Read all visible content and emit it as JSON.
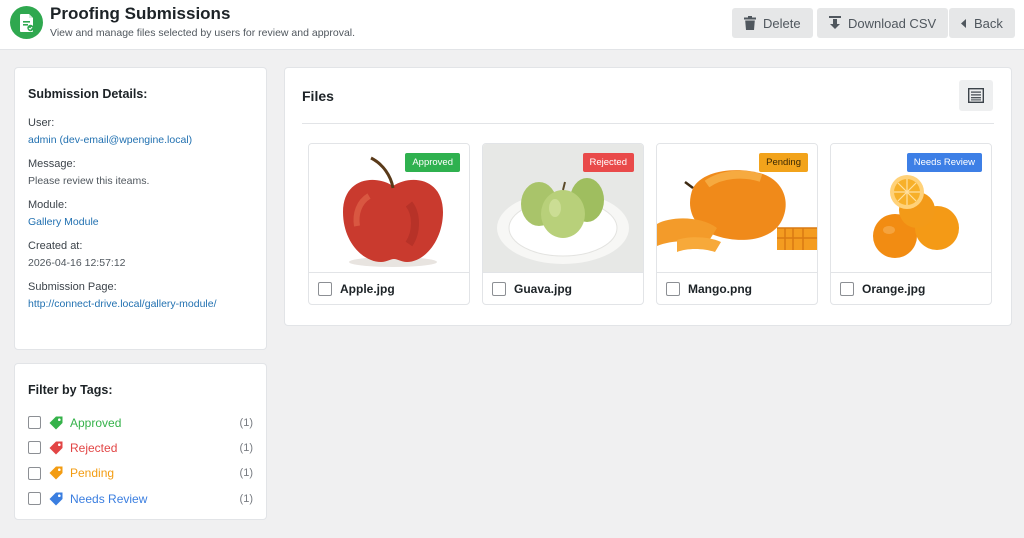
{
  "header": {
    "title": "Proofing Submissions",
    "subtitle": "View and manage files selected by users for review and approval.",
    "buttons": {
      "delete": "Delete",
      "download": "Download CSV",
      "back": "Back"
    }
  },
  "details": {
    "heading": "Submission Details:",
    "user_label": "User:",
    "user_value": "admin (dev-email@wpengine.local)",
    "message_label": "Message:",
    "message_value": "Please review this iteams.",
    "module_label": "Module:",
    "module_value": "Gallery Module",
    "created_label": "Created at:",
    "created_value": "2026-04-16 12:57:12",
    "page_label": "Submission Page:",
    "page_value": "http://connect-drive.local/gallery-module/"
  },
  "filter": {
    "heading": "Filter by Tags:",
    "tags": [
      {
        "label": "Approved",
        "count": "(1)",
        "color": "#35b24a"
      },
      {
        "label": "Rejected",
        "count": "(1)",
        "color": "#e24545"
      },
      {
        "label": "Pending",
        "count": "(1)",
        "color": "#f39c12"
      },
      {
        "label": "Needs Review",
        "count": "(1)",
        "color": "#3a7ee0"
      }
    ]
  },
  "files": {
    "heading": "Files",
    "items": [
      {
        "name": "Apple.jpg",
        "badge": "Approved",
        "badge_color": "#2fb14f",
        "badge_text_color": "#ffffff"
      },
      {
        "name": "Guava.jpg",
        "badge": "Rejected",
        "badge_color": "#e94a4a",
        "badge_text_color": "#ffffff"
      },
      {
        "name": "Mango.png",
        "badge": "Pending",
        "badge_color": "#f2a31b",
        "badge_text_color": "#3b2a05"
      },
      {
        "name": "Orange.jpg",
        "badge": "Needs Review",
        "badge_color": "#3d7fe6",
        "badge_text_color": "#ffffff"
      }
    ]
  },
  "colors": {
    "accent": "#2fa84f",
    "link": "#2271b1"
  }
}
